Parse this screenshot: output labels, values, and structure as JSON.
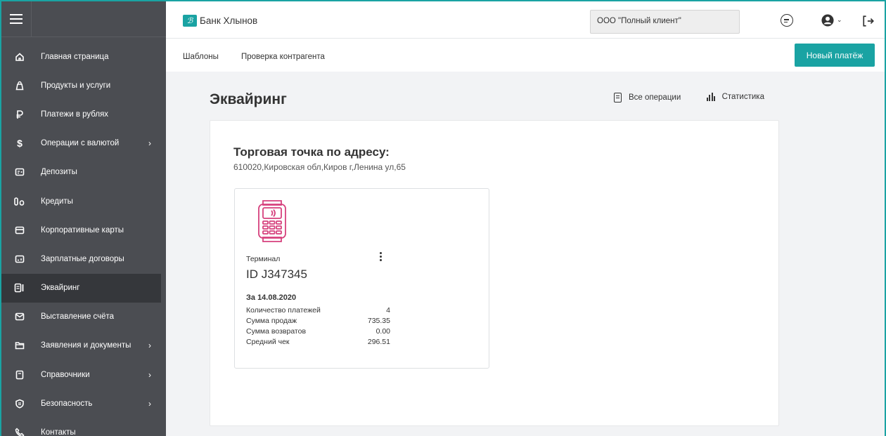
{
  "header": {
    "bank_name": "Банк Хлынов",
    "client": "ООО \"Полный клиент\""
  },
  "sidebar": {
    "items": [
      {
        "label": "Главная страница",
        "icon": "home-icon",
        "chevron": false,
        "active": false
      },
      {
        "label": "Продукты и услуги",
        "icon": "bag-icon",
        "chevron": false,
        "active": false
      },
      {
        "label": "Платежи в рублях",
        "icon": "ruble-icon",
        "chevron": false,
        "active": false
      },
      {
        "label": "Операции с валютой",
        "icon": "dollar-icon",
        "chevron": true,
        "active": false
      },
      {
        "label": "Депозиты",
        "icon": "deposit-icon",
        "chevron": false,
        "active": false
      },
      {
        "label": "Кредиты",
        "icon": "credit-icon",
        "chevron": false,
        "active": false
      },
      {
        "label": "Корпоративные карты",
        "icon": "card-icon",
        "chevron": false,
        "active": false
      },
      {
        "label": "Зарплатные договоры",
        "icon": "salary-icon",
        "chevron": false,
        "active": false
      },
      {
        "label": "Эквайринг",
        "icon": "acquiring-icon",
        "chevron": false,
        "active": true
      },
      {
        "label": "Выставление счёта",
        "icon": "invoice-icon",
        "chevron": false,
        "active": false
      },
      {
        "label": "Заявления и документы",
        "icon": "folder-icon",
        "chevron": true,
        "active": false
      },
      {
        "label": "Справочники",
        "icon": "book-icon",
        "chevron": true,
        "active": false
      },
      {
        "label": "Безопасность",
        "icon": "shield-icon",
        "chevron": true,
        "active": false
      },
      {
        "label": "Контакты",
        "icon": "phone-icon",
        "chevron": false,
        "active": false
      }
    ]
  },
  "subnav": {
    "templates": "Шаблоны",
    "counterparty_check": "Проверка контрагента",
    "new_payment": "Новый платёж"
  },
  "page": {
    "title": "Эквайринг",
    "all_operations": "Все операции",
    "statistics": "Статистика"
  },
  "point": {
    "title": "Торговая точка по адресу:",
    "address": "610020,Кировская обл,Киров г,Ленина ул,65",
    "terminal": {
      "kind": "Терминал",
      "id": "ID J347345",
      "date_label": "За 14.08.2020",
      "stats": [
        {
          "label": "Количество платежей",
          "value": "4"
        },
        {
          "label": "Сумма продаж",
          "value": "735.35"
        },
        {
          "label": "Сумма возвратов",
          "value": "0.00"
        },
        {
          "label": "Средний чек",
          "value": "296.51"
        }
      ]
    }
  },
  "colors": {
    "accent": "#1aa3a3",
    "sidebar_bg": "#4b4d52",
    "sidebar_active": "#35373b",
    "terminal_icon": "#d6417d"
  }
}
